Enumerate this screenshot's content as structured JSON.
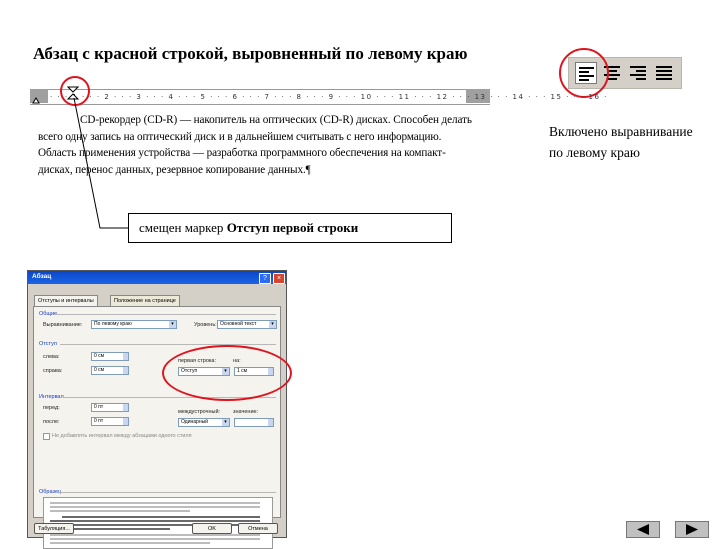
{
  "slide": {
    "title": "Абзац с красной строкой, выровненный по левому краю",
    "paragraph": {
      "line1": "CD-рекордер (CD-R) — накопитель на оптических (CD-R) дисках.",
      "rest": "Способен делать всего одну запись на оптический диск и в дальнейшем считывать с него информацию. Область применения устройства — разработка программного обеспечения на компакт-дисках, перенос данных, резервное копирование данных.¶"
    },
    "callout": {
      "prefix": "смещен маркер ",
      "bold": "Отступ первой строки"
    },
    "note": {
      "text": "Включено выравнивание по левому краю"
    }
  },
  "toolbar": {
    "buttons": [
      "align-left",
      "align-center",
      "align-right",
      "justify"
    ],
    "active": "align-left"
  },
  "dialog": {
    "title": "Абзац",
    "help_btn": "?",
    "close_btn": "×",
    "tabs": [
      "Отступы и интервалы",
      "Положение на странице"
    ],
    "general_group": "Общие",
    "alignment_label": "Выравнивание:",
    "alignment_value": "По левому краю",
    "level_label": "Уровень:",
    "level_value": "Основной текст",
    "indent_group": "Отступ",
    "left_label": "слева:",
    "left_value": "0 см",
    "right_label": "справа:",
    "right_value": "0 см",
    "first_line_label": "первая строка:",
    "first_line_value": "Отступ",
    "on_label": "на:",
    "on_value": "1 см",
    "spacing_group": "Интервал",
    "before_label": "перед:",
    "before_value": "0 пт",
    "after_label": "после:",
    "after_value": "0 пт",
    "line_spacing_label": "междустрочный:",
    "line_spacing_value": "Одинарный",
    "value_label": "значение:",
    "checkbox_label": "Не добавлять интервал между абзацами одного стиля",
    "preview_group": "Образец",
    "tabs_button": "Табуляция...",
    "ok_button": "OK",
    "cancel_button": "Отмена"
  },
  "nav": {
    "prev": "◀",
    "next": "▶"
  },
  "colors": {
    "highlight": "#e0141e",
    "dialog_bg": "#d4d0c8",
    "titlebar": "#0a46c8"
  }
}
